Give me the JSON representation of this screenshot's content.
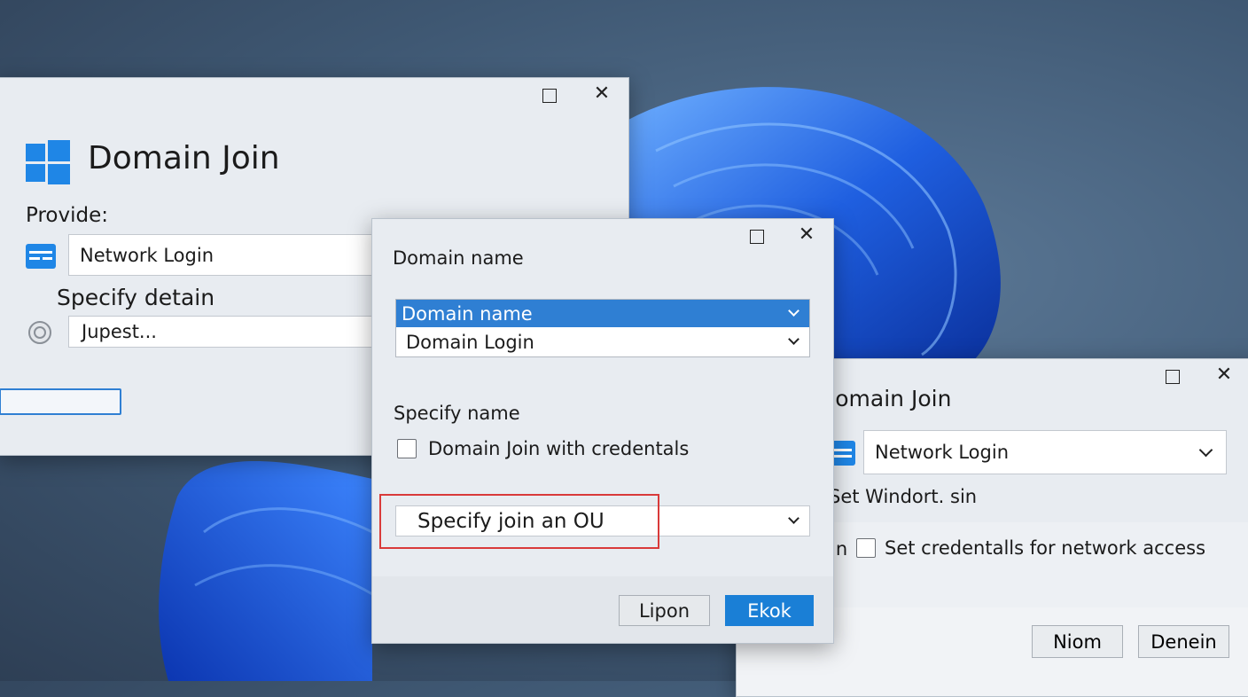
{
  "colors": {
    "accent": "#2f7fd3",
    "highlight": "#d93a3a",
    "button_primary": "#1a7fd6"
  },
  "left_window": {
    "title": "Domain Join",
    "provide_label": "Provide:",
    "network_login_value": "Network Login",
    "specify_label": "Specify detain",
    "second_value": "Jupest..."
  },
  "center_dialog": {
    "heading": "Domain name",
    "dropdown_selected": "Domain name",
    "dropdown_option": "Domain Login",
    "specify_name_label": "Specify name",
    "checkbox_label": "Domain Join with credentals",
    "ou_dropdown_value": "Specify join an OU",
    "cancel_button": "Lipon",
    "ok_button": "Ekok"
  },
  "right_window": {
    "title": "Domain Join",
    "network_login_value": "Network Login",
    "sub_label": "Set Windort. sin",
    "row_prefix": "in",
    "checkbox_label": "Set credentalls for network access",
    "button_one": "Niom",
    "button_two": "Denein"
  }
}
